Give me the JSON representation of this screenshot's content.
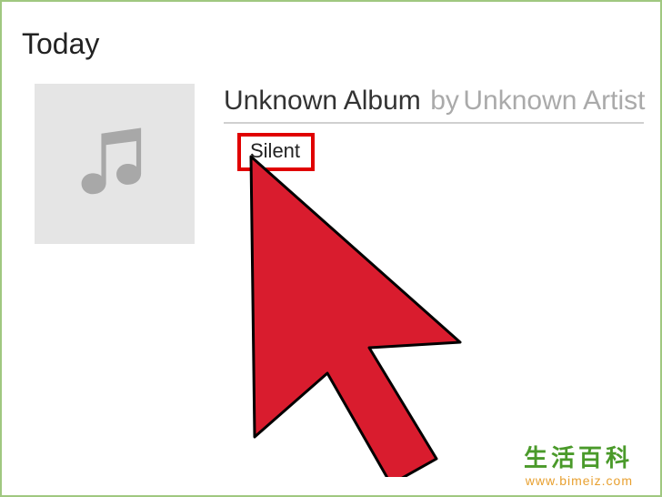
{
  "section_title": "Today",
  "album": {
    "title": "Unknown Album",
    "by_label": "by",
    "artist": "Unknown Artist"
  },
  "track": {
    "name": "Silent"
  },
  "watermark": {
    "title": "生活百科",
    "url": "www.bimeiz.com"
  }
}
